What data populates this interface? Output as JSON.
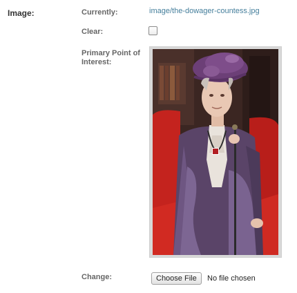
{
  "form": {
    "field_label": "Image:",
    "currently_label": "Currently:",
    "current_file": "image/the-dowager-countess.jpg",
    "clear_label": "Clear:",
    "clear_checked": false,
    "poi_label": "Primary Point of Interest:",
    "change_label": "Change:",
    "choose_file_button": "Choose File",
    "file_status": "No file chosen"
  },
  "colors": {
    "link": "#447e9b",
    "label": "#666666",
    "poi_marker": "#b21e22"
  },
  "icons": {
    "poi_marker": "poi-marker-square"
  }
}
